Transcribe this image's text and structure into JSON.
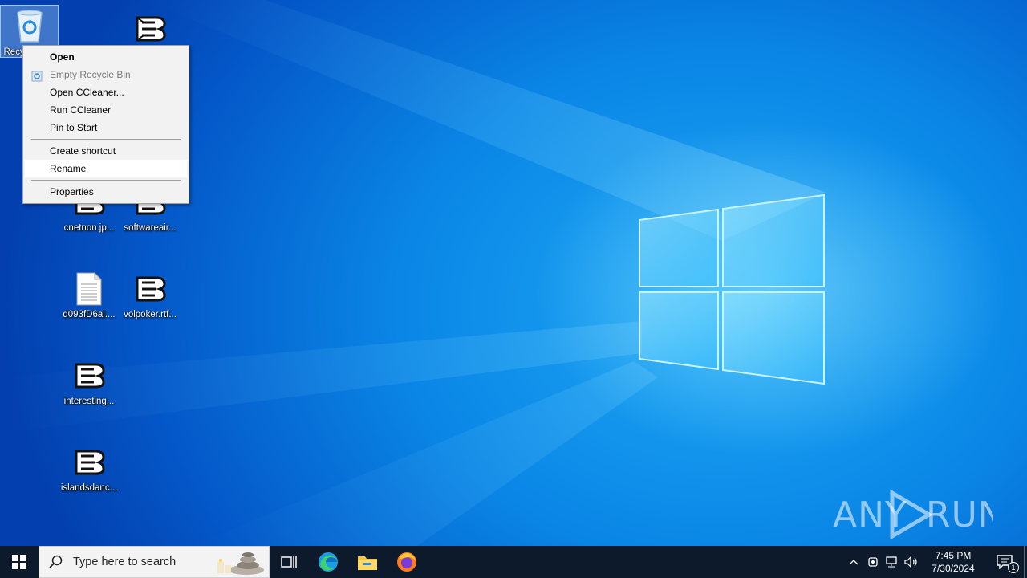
{
  "desktop": {
    "icons": [
      {
        "label": "Recycle Bin",
        "label_visible": "Recy",
        "icon": "recycle-bin-icon"
      },
      {
        "label": "",
        "icon": "ccleaner-file-icon"
      },
      {
        "label": "cnetnon.jp...",
        "icon": "ccleaner-file-icon"
      },
      {
        "label": "softwareair...",
        "icon": "ccleaner-file-icon"
      },
      {
        "label": "d093fD6al....",
        "icon": "text-document-icon"
      },
      {
        "label": "volpoker.rtf...",
        "icon": "ccleaner-file-icon"
      },
      {
        "label": "interesting...",
        "icon": "ccleaner-file-icon"
      },
      {
        "label": "islandsdanc...",
        "icon": "ccleaner-file-icon"
      }
    ]
  },
  "context_menu": {
    "items": [
      {
        "label": "Open",
        "style": "bold"
      },
      {
        "label": "Empty Recycle Bin",
        "style": "disabled",
        "icon": "recycle-bin-icon"
      },
      {
        "label": "Open CCleaner..."
      },
      {
        "label": "Run CCleaner"
      },
      {
        "label": "Pin to Start"
      },
      {
        "label": "Create shortcut"
      },
      {
        "label": "Rename",
        "style": "hover"
      },
      {
        "label": "Properties"
      }
    ]
  },
  "taskbar": {
    "search_placeholder": "Type here to search",
    "apps": [
      "task-view-icon",
      "edge-icon",
      "file-explorer-icon",
      "firefox-icon"
    ],
    "clock": {
      "time": "7:45 PM",
      "date": "7/30/2024"
    },
    "notification_count": "1"
  },
  "watermark": {
    "text": "ANY RUN"
  },
  "colors": {
    "accent": "#0a86e6",
    "taskbar": "#0c1a2b",
    "menu_bg": "#f2f2f2"
  }
}
